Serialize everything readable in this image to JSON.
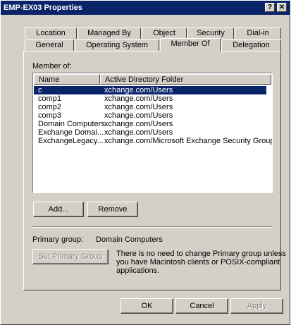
{
  "window": {
    "title": "EMP-EX03 Properties",
    "help_label": "?",
    "close_label": "✕"
  },
  "tabs_row1": [
    {
      "label": "Location"
    },
    {
      "label": "Managed By"
    },
    {
      "label": "Object"
    },
    {
      "label": "Security"
    },
    {
      "label": "Dial-in"
    }
  ],
  "tabs_row2": [
    {
      "label": "General"
    },
    {
      "label": "Operating System"
    },
    {
      "label": "Member Of"
    },
    {
      "label": "Delegation"
    }
  ],
  "member_of": {
    "label": "Member of:",
    "columns": [
      "Name",
      "Active Directory Folder"
    ],
    "rows": [
      {
        "name": "c",
        "folder": "xchange.com/Users",
        "selected": true
      },
      {
        "name": "comp1",
        "folder": "xchange.com/Users"
      },
      {
        "name": "comp2",
        "folder": "xchange.com/Users"
      },
      {
        "name": "comp3",
        "folder": "xchange.com/Users"
      },
      {
        "name": "Domain Computers",
        "folder": "xchange.com/Users"
      },
      {
        "name": "Exchange Domai...",
        "folder": "xchange.com/Users"
      },
      {
        "name": "ExchangeLegacy...",
        "folder": "xchange.com/Microsoft Exchange Security Groups"
      }
    ]
  },
  "buttons": {
    "add": "Add...",
    "remove": "Remove",
    "set_primary": "Set Primary Group",
    "ok": "OK",
    "cancel": "Cancel",
    "apply": "Apply"
  },
  "primary_group": {
    "label": "Primary group:",
    "value": "Domain Computers",
    "note_line1": "There is no need to change Primary group unless",
    "note_line2": "you have Macintosh clients or POSIX-compliant",
    "note_line3": "applications."
  }
}
